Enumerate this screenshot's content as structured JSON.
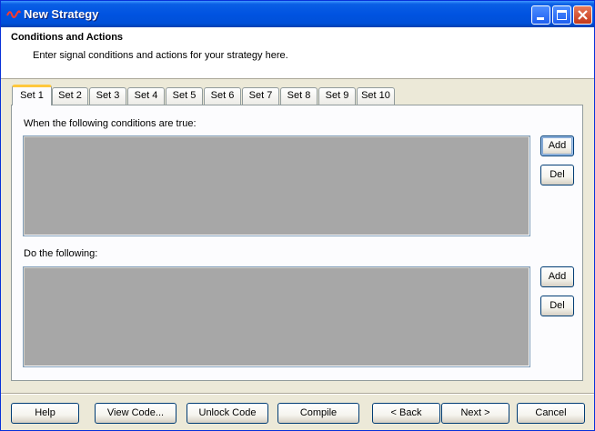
{
  "window": {
    "title": "New Strategy"
  },
  "header": {
    "title": "Conditions and Actions",
    "subtitle": "Enter signal conditions and actions for your strategy here."
  },
  "tabs": [
    {
      "label": "Set 1",
      "active": true
    },
    {
      "label": "Set 2"
    },
    {
      "label": "Set 3"
    },
    {
      "label": "Set 4"
    },
    {
      "label": "Set 5"
    },
    {
      "label": "Set 6"
    },
    {
      "label": "Set 7"
    },
    {
      "label": "Set 8"
    },
    {
      "label": "Set 9"
    },
    {
      "label": "Set 10"
    }
  ],
  "conditions": {
    "label": "When the following conditions are true:",
    "add_label": "Add",
    "del_label": "Del"
  },
  "actions": {
    "label": "Do the following:",
    "add_label": "Add",
    "del_label": "Del"
  },
  "footer": {
    "help": "Help",
    "view_code": "View Code...",
    "unlock_code": "Unlock Code",
    "compile": "Compile",
    "back": "< Back",
    "next": "Next >",
    "cancel": "Cancel"
  },
  "colors": {
    "titlebar": "#0053e1",
    "dialog_bg": "#ece9d8",
    "listbox_bg": "#a7a7a7",
    "active_tab_accent": "#ffc83c"
  }
}
